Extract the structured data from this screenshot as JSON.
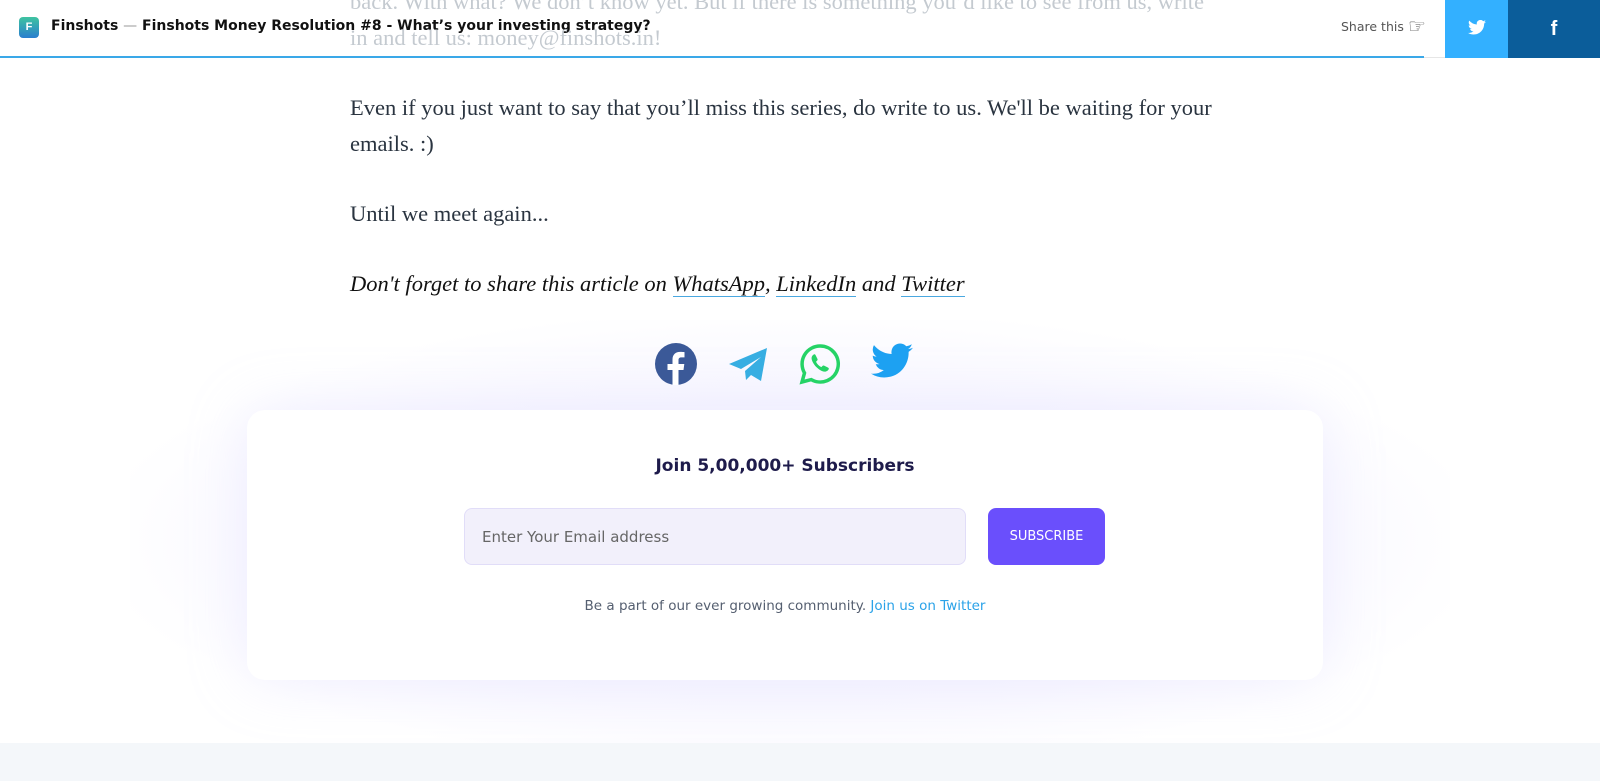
{
  "header": {
    "site": "Finshots",
    "separator": "—",
    "title": "Finshots Money Resolution #8 - What’s your investing strategy?",
    "share_label": "Share this",
    "progress_percent": 89
  },
  "article": {
    "faded_paragraph": "back. With what? We don’t know yet. But if there is something you’d like to see from us, write in and tell us: money@finshots.in!",
    "paragraphs": [
      "Even if you just want to say that you’ll miss this series, do write to us. We'll be waiting for your emails. :)",
      "Until we meet again..."
    ],
    "share_prefix": "Don't forget to share this article on ",
    "links": [
      "WhatsApp",
      "LinkedIn",
      "Twitter"
    ],
    "comma": ", ",
    "and": " and "
  },
  "share_icons": [
    "facebook-icon",
    "telegram-icon",
    "whatsapp-icon",
    "twitter-icon"
  ],
  "subscribe": {
    "heading": "Join 5,00,000+ Subscribers",
    "placeholder": "Enter Your Email address",
    "button": "SUBSCRIBE",
    "note": "Be a part of our ever growing community. ",
    "note_link": "Join us on Twitter"
  },
  "colors": {
    "accent": "#6a4ffc",
    "twitter": "#33b0ff",
    "facebook": "#0b5d9a",
    "link": "#2aa2e8"
  }
}
